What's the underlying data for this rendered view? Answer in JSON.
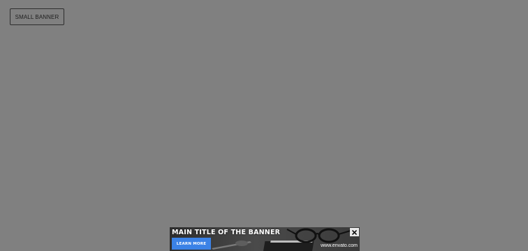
{
  "toolbar": {
    "small_banner_label": "SMALL BANNER"
  },
  "banner": {
    "title": "MAIN TITLE OF THE BANNER",
    "cta_label": "LEARN MORE",
    "url_text": "www.envato.com",
    "close_icon": "close-icon",
    "cta_color": "#3b82e6"
  },
  "colors": {
    "page_background": "#808080",
    "banner_background": "#3c3c3c"
  }
}
